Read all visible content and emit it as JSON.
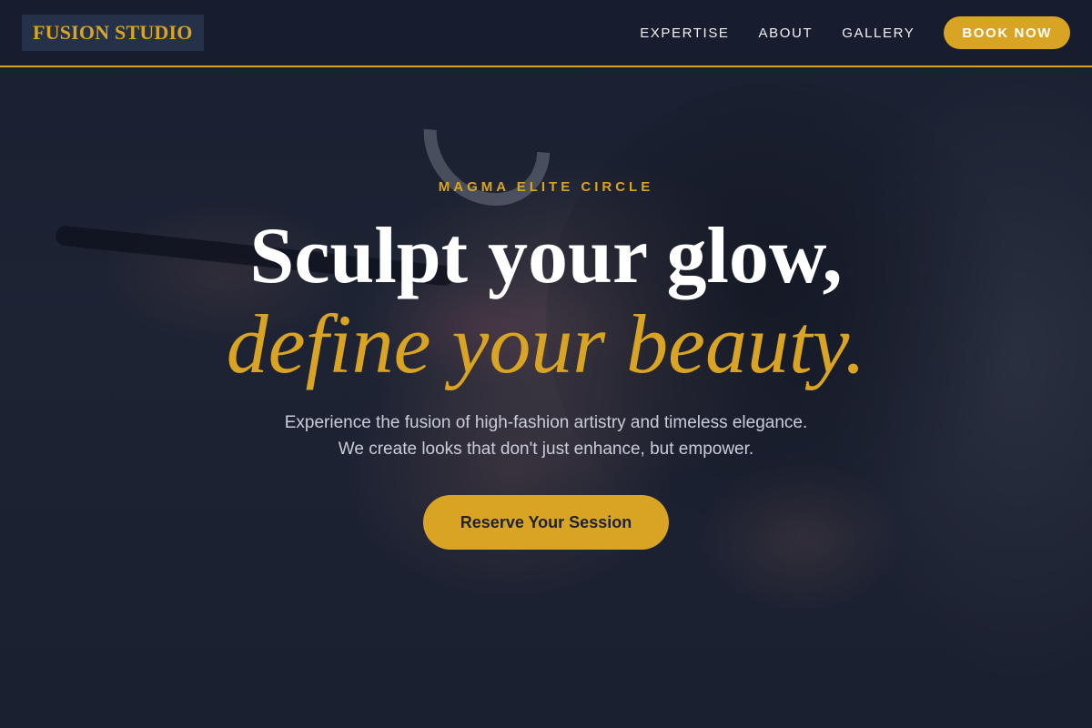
{
  "header": {
    "logo": "FUSION STUDIO",
    "nav": [
      {
        "label": "EXPERTISE"
      },
      {
        "label": "ABOUT"
      },
      {
        "label": "GALLERY"
      }
    ],
    "book_label": "BOOK NOW"
  },
  "hero": {
    "eyebrow": "MAGMA ELITE CIRCLE",
    "headline_line1": "Sculpt your glow,",
    "headline_line2": "define your beauty.",
    "subtext_line1": "Experience the fusion of high-fashion artistry and timeless elegance.",
    "subtext_line2": "We create looks that don't just enhance, but empower.",
    "cta_label": "Reserve Your Session"
  },
  "colors": {
    "accent": "#d9a424",
    "overlay": "#141a2a",
    "logo_bg": "#253149"
  }
}
